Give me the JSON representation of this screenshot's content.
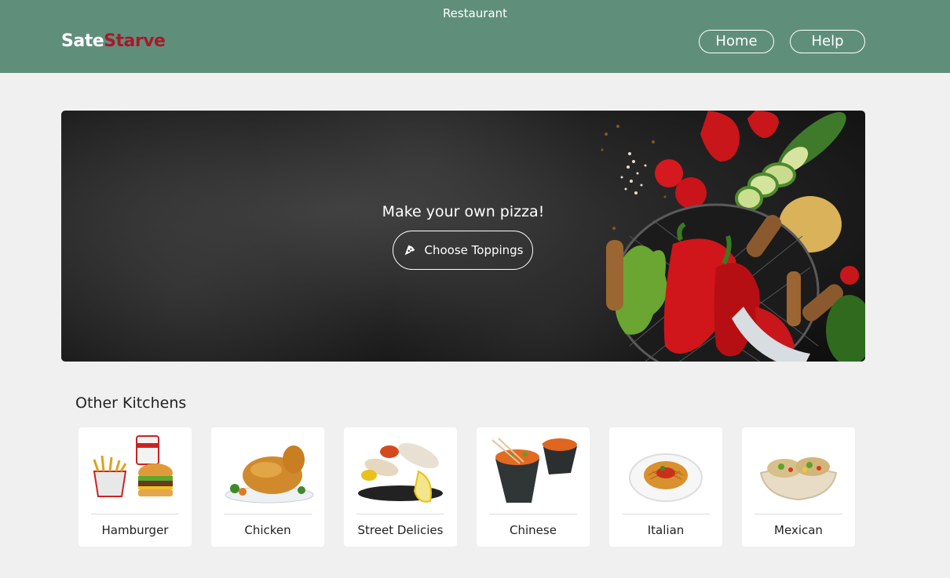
{
  "header": {
    "app_title": "Restaurant",
    "brand_part1": "Sate",
    "brand_part2": "Starve",
    "nav": {
      "home": "Home",
      "help": "Help"
    }
  },
  "hero": {
    "headline": "Make your own pizza!",
    "button_label": "Choose Toppings",
    "button_icon": "pizza-icon"
  },
  "kitchens": {
    "title": "Other Kitchens",
    "items": [
      {
        "label": "Hamburger",
        "image": "hamburger-image"
      },
      {
        "label": "Chicken",
        "image": "chicken-image"
      },
      {
        "label": "Street Delicies",
        "image": "street-food-image"
      },
      {
        "label": "Chinese",
        "image": "chinese-food-image"
      },
      {
        "label": "Italian",
        "image": "italian-food-image"
      },
      {
        "label": "Mexican",
        "image": "mexican-food-image"
      }
    ]
  },
  "colors": {
    "header_bg": "#5f8f7b",
    "brand_accent": "#a8192a",
    "page_bg": "#f0f0f0"
  }
}
